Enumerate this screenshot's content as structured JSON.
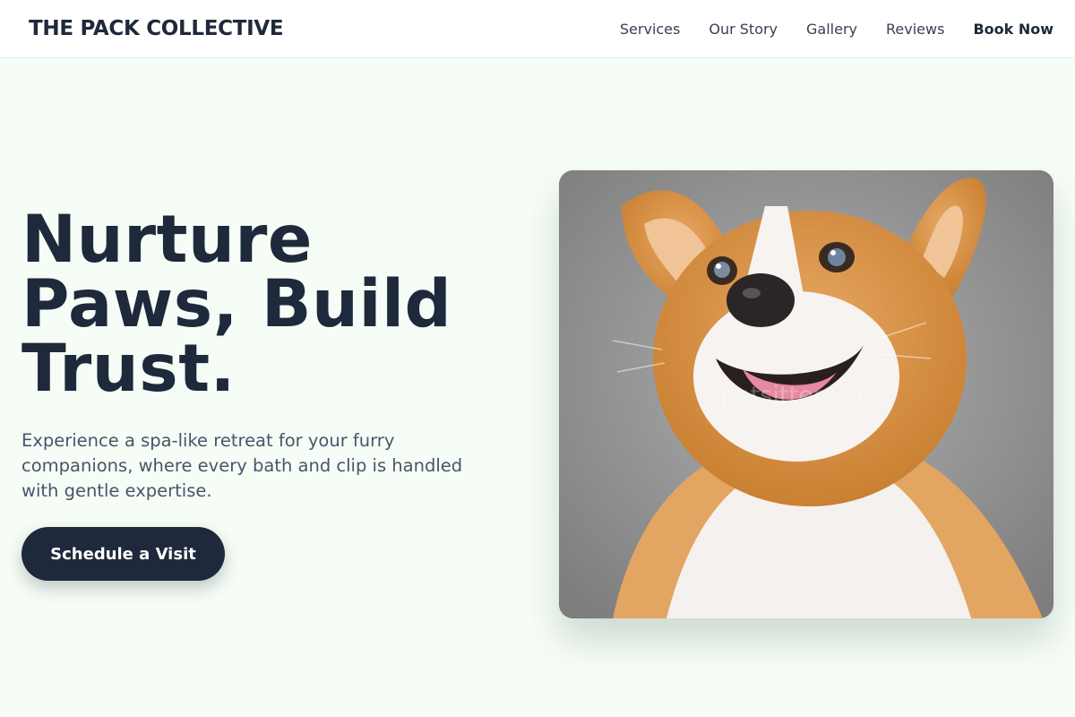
{
  "header": {
    "brand": "THE PACK COLLECTIVE",
    "nav": [
      {
        "label": "Services"
      },
      {
        "label": "Our Story"
      },
      {
        "label": "Gallery"
      },
      {
        "label": "Reviews"
      },
      {
        "label": "Book Now"
      }
    ]
  },
  "hero": {
    "headline_lines": [
      "Nurture",
      "Paws, Build",
      "Trust."
    ],
    "subtext": "Experience a spa-like retreat for your furry companions, where every bath and clip is handled with gentle expertise.",
    "cta_label": "Schedule a Visit",
    "image_watermark": "petsitters.site"
  },
  "colors": {
    "background": "#f6fdf6",
    "primary": "#1e293b",
    "body_text": "#475569"
  }
}
